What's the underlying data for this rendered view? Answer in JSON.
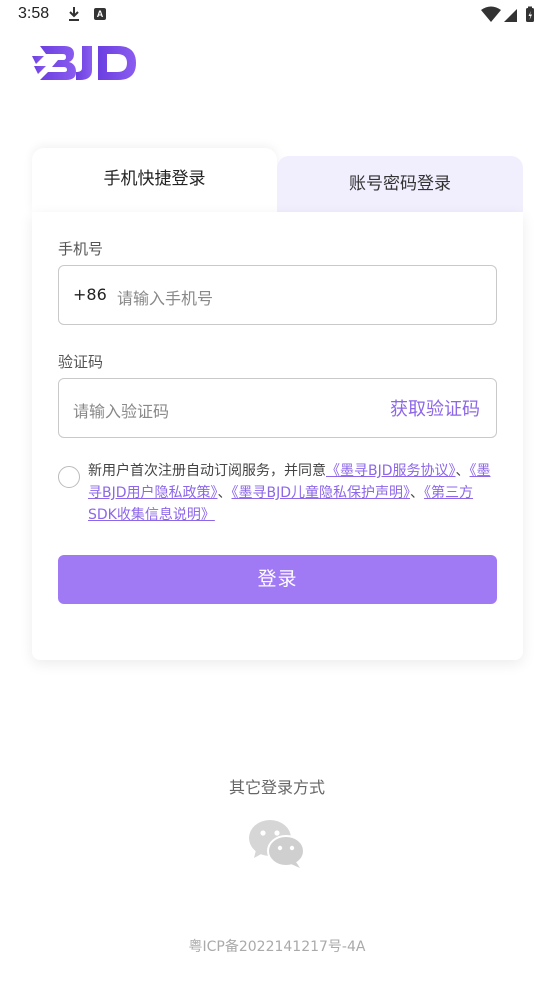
{
  "status": {
    "time": "3:58",
    "a_badge": "A"
  },
  "brand": {
    "logo_text": "BJD"
  },
  "tabs": {
    "quick": "手机快捷登录",
    "password": "账号密码登录"
  },
  "form": {
    "phone_label": "手机号",
    "country_code": "+86",
    "phone_placeholder": "请输入手机号",
    "code_label": "验证码",
    "code_placeholder": "请输入验证码",
    "get_code": "获取验证码"
  },
  "agreement": {
    "prefix": "新用户首次注册自动订阅服务，并同意",
    "link1": "《墨寻BJD服务协议》",
    "sep1": "、",
    "link2": "《墨寻BJD用户隐私政策》",
    "sep2": "、",
    "link3": "《墨寻BJD儿童隐私保护声明》",
    "sep3": "、",
    "link4": "《第三方SDK收集信息说明》"
  },
  "login_button": "登录",
  "other_login": "其它登录方式",
  "icp": "粤ICP备2022141217号-4A",
  "colors": {
    "accent": "#8c67e8",
    "button": "#a07af5",
    "tab_inactive": "#f1eefe"
  }
}
